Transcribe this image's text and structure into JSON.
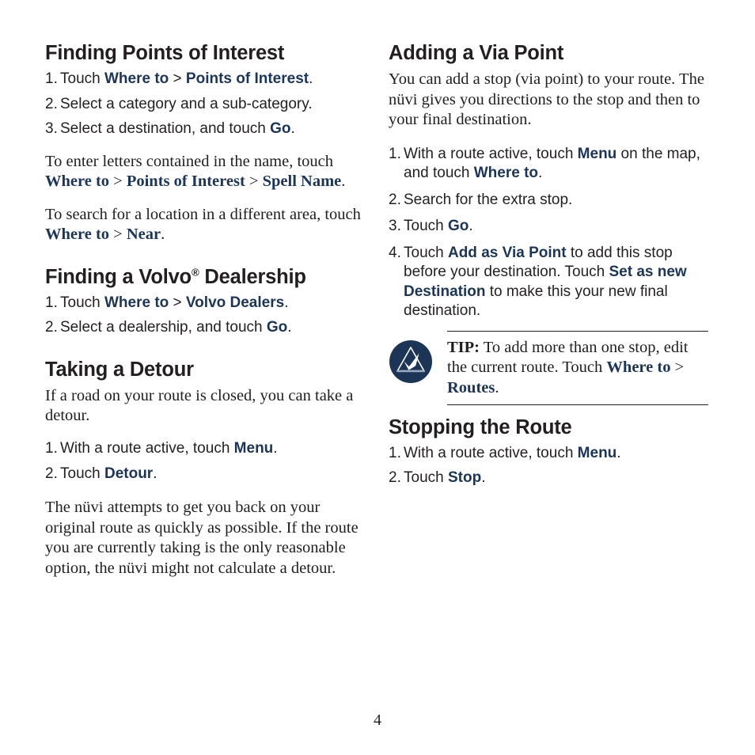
{
  "page": {
    "number": "4",
    "accent_color": "#1c3557",
    "text_color": "#231f20"
  },
  "left_column": {
    "section1": {
      "heading": "Finding Points of Interest",
      "steps": [
        {
          "num": "1.",
          "pre": "Touch ",
          "ui1": "Where to",
          "sep": " > ",
          "ui2": "Points of Interest",
          "post": "."
        },
        {
          "num": "2.",
          "pre": "Select a category and a sub-category.",
          "ui1": "",
          "sep": "",
          "ui2": "",
          "post": ""
        },
        {
          "num": "3.",
          "pre": "Select a destination, and touch ",
          "ui1": "Go",
          "sep": "",
          "ui2": "",
          "post": "."
        }
      ],
      "para1": {
        "pre": "To enter letters contained in the name, touch ",
        "ui1": "Where to",
        "sep1": " > ",
        "ui2": "Points of Interest",
        "sep2": " > ",
        "ui3": "Spell Name",
        "post": "."
      },
      "para2": {
        "pre": "To search for a location in a different area, touch ",
        "ui1": "Where to",
        "sep1": " > ",
        "ui2": "Near",
        "post": "."
      }
    },
    "section2": {
      "heading_pre": "Finding a Volvo",
      "heading_sup": "®",
      "heading_post": " Dealership",
      "steps": [
        {
          "num": "1.",
          "pre": "Touch ",
          "ui1": "Where to",
          "sep": " > ",
          "ui2": "Volvo Dealers",
          "post": "."
        },
        {
          "num": "2.",
          "pre": "Select a dealership, and touch ",
          "ui1": "Go",
          "sep": "",
          "ui2": "",
          "post": "."
        }
      ]
    },
    "section3": {
      "heading": "Taking a Detour",
      "intro": "If a road on your route is closed, you can take a detour.",
      "steps": [
        {
          "num": "1.",
          "pre": "With a route active, touch ",
          "ui1": "Menu",
          "sep": "",
          "ui2": "",
          "post": "."
        },
        {
          "num": "2.",
          "pre": "Touch ",
          "ui1": "Detour",
          "sep": "",
          "ui2": "",
          "post": "."
        }
      ],
      "outro": "The nüvi attempts to get you back on your original route as quickly as possible. If the route you are currently taking is the only reasonable option, the nüvi might not calculate a detour."
    }
  },
  "right_column": {
    "section1": {
      "heading": "Adding a Via Point",
      "intro": "You can add a stop (via point) to your route. The nüvi gives you directions to the stop and then to your final destination.",
      "steps": [
        {
          "num": "1.",
          "pre": "With a route active, touch ",
          "ui1": "Menu",
          "mid": " on the map, and touch ",
          "ui2": "Where to",
          "post": "."
        },
        {
          "num": "2.",
          "pre": "Search for the extra stop.",
          "ui1": "",
          "mid": "",
          "ui2": "",
          "post": ""
        },
        {
          "num": "3.",
          "pre": "Touch ",
          "ui1": "Go",
          "mid": "",
          "ui2": "",
          "post": "."
        },
        {
          "num": "4.",
          "pre": "Touch ",
          "ui1": "Add as Via Point",
          "mid": " to add this stop before your destination. Touch ",
          "ui2": "Set as new Destination",
          "post": " to make this your new final destination."
        }
      ]
    },
    "tip": {
      "icon_name": "tip-triangle-check-icon",
      "label": "TIP:",
      "pre": " To add more than one stop, edit the current route. Touch ",
      "ui1": "Where to",
      "sep": " > ",
      "ui2": "Routes",
      "post": "."
    },
    "section2": {
      "heading": "Stopping the Route",
      "steps": [
        {
          "num": "1.",
          "pre": "With a route active, touch ",
          "ui1": "Menu",
          "sep": "",
          "ui2": "",
          "post": "."
        },
        {
          "num": "2.",
          "pre": "Touch ",
          "ui1": "Stop",
          "sep": "",
          "ui2": "",
          "post": "."
        }
      ]
    }
  }
}
